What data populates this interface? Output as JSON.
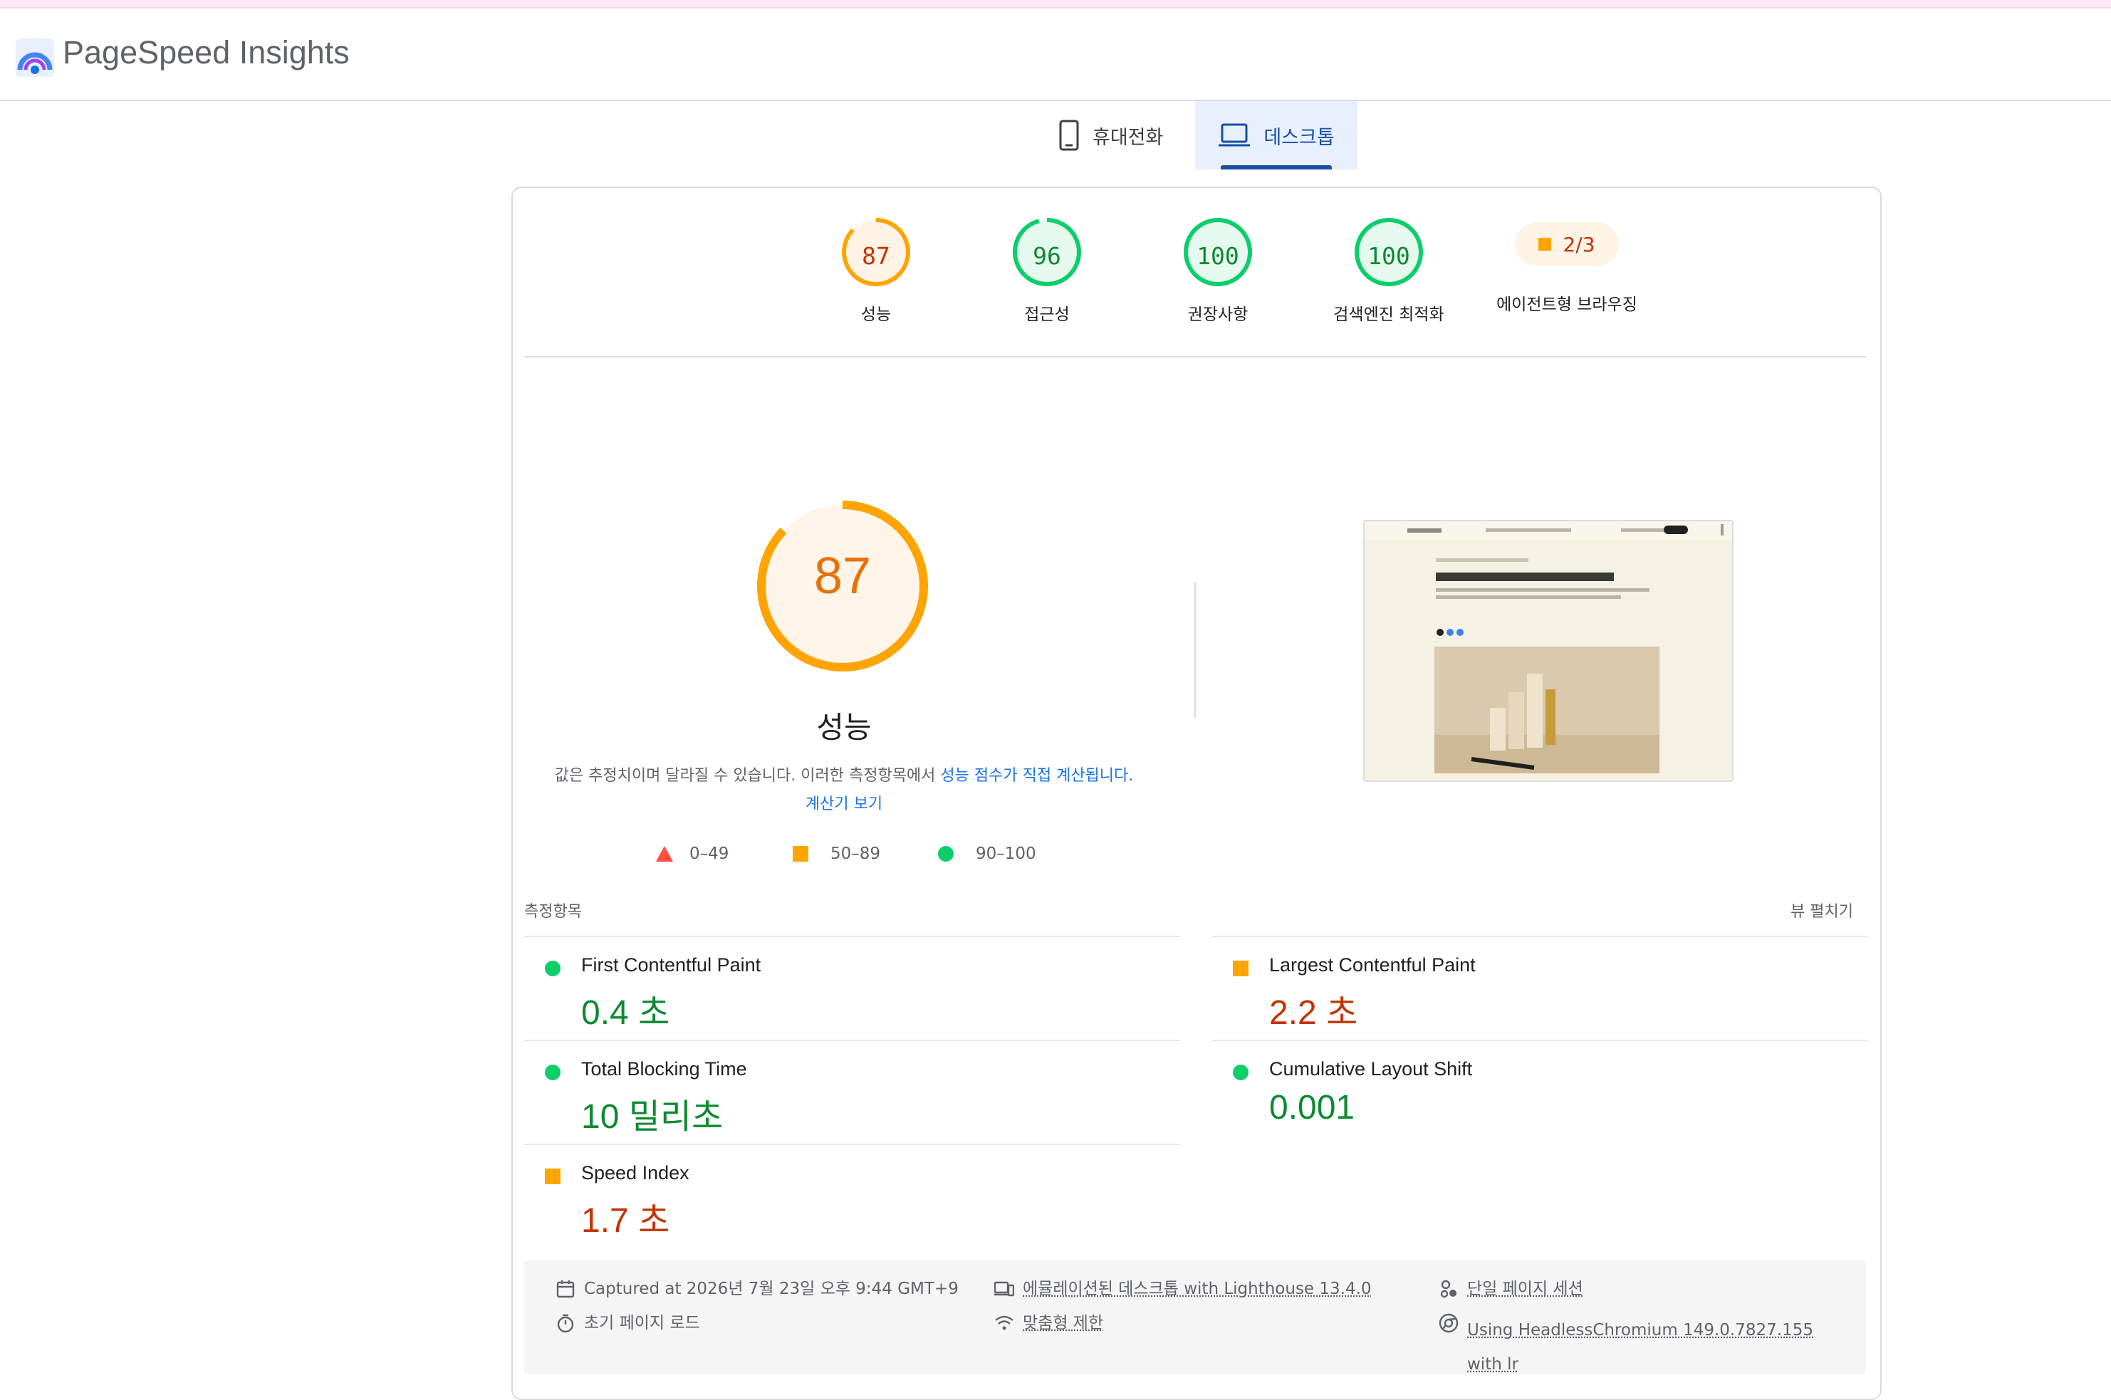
{
  "app": {
    "title": "PageSpeed Insights"
  },
  "tabs": [
    {
      "label": "휴대전화",
      "icon": "phone-icon",
      "selected": false
    },
    {
      "label": "데스크톱",
      "icon": "laptop-icon",
      "selected": true
    }
  ],
  "categories": [
    {
      "label": "성능",
      "score": "87",
      "status": "average"
    },
    {
      "label": "접근성",
      "score": "96",
      "status": "pass"
    },
    {
      "label": "권장사항",
      "score": "100",
      "status": "pass"
    },
    {
      "label": "검색엔진 최적화",
      "score": "100",
      "status": "pass"
    },
    {
      "label": "에이전트형 브라우징",
      "score": "2/3",
      "status": "average"
    }
  ],
  "performance": {
    "score": "87",
    "title": "성능",
    "desc_text": "값은 추정치이며 달라질 수 있습니다. 이러한 측정항목에서 ",
    "desc_link1": "성능 점수가 직접 계산됩니다",
    "desc_link2": "계산기 보기"
  },
  "legend": [
    {
      "range": "0–49",
      "shape": "triangle",
      "color": "#ff4e42"
    },
    {
      "range": "50–89",
      "shape": "square",
      "color": "#ffa400"
    },
    {
      "range": "90–100",
      "shape": "circle",
      "color": "#0cce6b"
    }
  ],
  "metrics_section": {
    "title": "측정항목",
    "expand_label": "뷰 펼치기"
  },
  "metrics": [
    {
      "name": "First Contentful Paint",
      "value": "0.4 초",
      "status": "pass"
    },
    {
      "name": "Largest Contentful Paint",
      "value": "2.2 초",
      "status": "average"
    },
    {
      "name": "Total Blocking Time",
      "value": "10 밀리초",
      "status": "pass"
    },
    {
      "name": "Cumulative Layout Shift",
      "value": "0.001",
      "status": "pass"
    },
    {
      "name": "Speed Index",
      "value": "1.7 초",
      "status": "average"
    }
  ],
  "footer": {
    "captured": "Captured at 2026년 7월 23일 오후 9:44 GMT+9",
    "initial_load": "초기 페이지 로드",
    "emulated": "에뮬레이션된 데스크톱 with Lighthouse 13.4.0",
    "throttling": "맞춤형 제한",
    "session": "단일 페이지 세션",
    "browser": "Using HeadlessChromium 149.0.7827.155 with lr"
  },
  "colors": {
    "pass": "#0cce6b",
    "average": "#ffa400",
    "fail": "#ff4e42",
    "accent": "#1a73e8"
  }
}
